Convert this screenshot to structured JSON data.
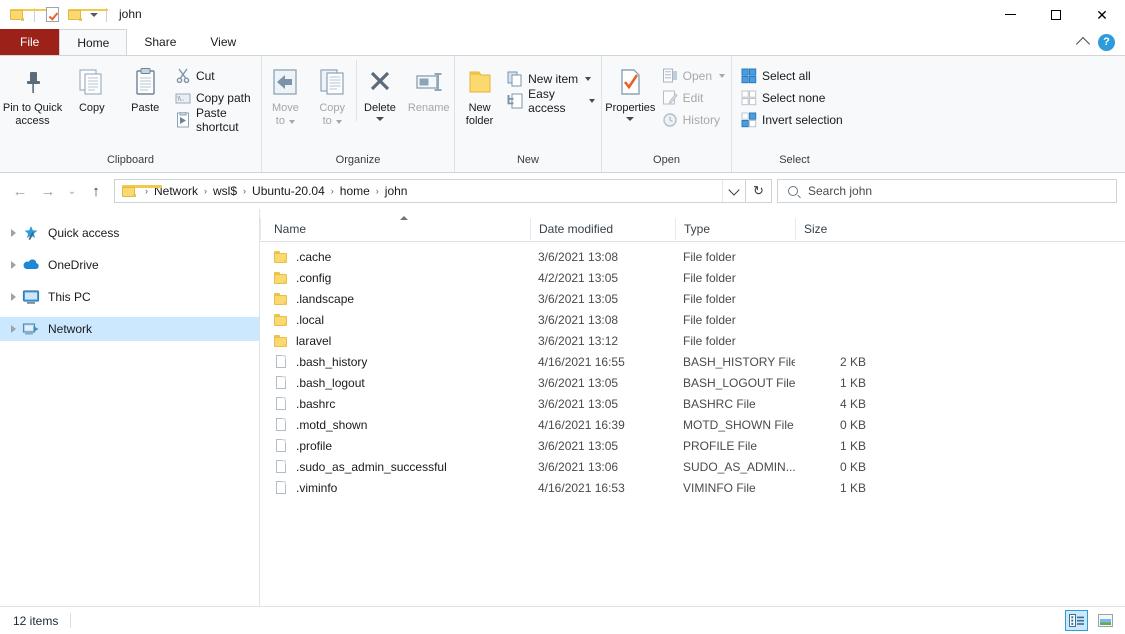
{
  "window": {
    "title": "john",
    "quick_access_toolbar": [
      {
        "name": "folder-icon",
        "label": "Properties"
      },
      {
        "name": "properties-icon",
        "label": "Properties"
      },
      {
        "name": "new-folder-icon",
        "label": "New folder"
      },
      {
        "name": "customize-caret",
        "label": "Customize Quick Access Toolbar"
      }
    ],
    "controls": {
      "minimize": "—",
      "maximize": "□",
      "close": "✕"
    }
  },
  "ribbon": {
    "tabs": [
      {
        "label": "File",
        "active": false,
        "kind": "file"
      },
      {
        "label": "Home",
        "active": true,
        "kind": "normal"
      },
      {
        "label": "Share",
        "active": false,
        "kind": "normal"
      },
      {
        "label": "View",
        "active": false,
        "kind": "normal"
      }
    ],
    "collapse_label": "Minimize the Ribbon",
    "help_label": "?",
    "groups": [
      {
        "label": "Clipboard",
        "big_buttons": [
          {
            "label_line1": "Pin to Quick",
            "label_line2": "access",
            "icon": "pin-icon",
            "disabled": false
          },
          {
            "label_line1": "Copy",
            "label_line2": "",
            "icon": "copy-icon",
            "disabled": false
          },
          {
            "label_line1": "Paste",
            "label_line2": "",
            "icon": "paste-icon",
            "disabled": false
          }
        ],
        "small_buttons": [
          {
            "label": "Cut",
            "icon": "cut-icon",
            "disabled": false,
            "caret": false
          },
          {
            "label": "Copy path",
            "icon": "copy-path-icon",
            "disabled": false,
            "caret": false
          },
          {
            "label": "Paste shortcut",
            "icon": "paste-shortcut-icon",
            "disabled": false,
            "caret": false
          }
        ]
      },
      {
        "label": "Organize",
        "big_buttons": [
          {
            "label_line1": "Move",
            "label_line2": "to",
            "icon": "move-to-icon",
            "disabled": true,
            "caret": true
          },
          {
            "label_line1": "Copy",
            "label_line2": "to",
            "icon": "copy-to-icon",
            "disabled": true,
            "caret": true
          },
          {
            "label_line1": "Delete",
            "label_line2": "",
            "icon": "delete-icon",
            "disabled": false,
            "caret": true
          },
          {
            "label_line1": "Rename",
            "label_line2": "",
            "icon": "rename-icon",
            "disabled": true,
            "caret": false
          }
        ],
        "small_buttons": []
      },
      {
        "label": "New",
        "big_buttons": [
          {
            "label_line1": "New",
            "label_line2": "folder",
            "icon": "new-folder-icon",
            "disabled": false
          }
        ],
        "small_buttons": [
          {
            "label": "New item",
            "icon": "new-item-icon",
            "disabled": false,
            "caret": true
          },
          {
            "label": "Easy access",
            "icon": "easy-access-icon",
            "disabled": false,
            "caret": true
          }
        ]
      },
      {
        "label": "Open",
        "big_buttons": [
          {
            "label_line1": "Properties",
            "label_line2": "",
            "icon": "properties-icon",
            "disabled": false,
            "caret": true
          }
        ],
        "small_buttons": [
          {
            "label": "Open",
            "icon": "open-icon",
            "disabled": true,
            "caret": true
          },
          {
            "label": "Edit",
            "icon": "edit-icon",
            "disabled": true,
            "caret": false
          },
          {
            "label": "History",
            "icon": "history-icon",
            "disabled": true,
            "caret": false
          }
        ]
      },
      {
        "label": "Select",
        "big_buttons": [],
        "small_buttons": [
          {
            "label": "Select all",
            "icon": "select-all-icon",
            "disabled": false,
            "caret": false
          },
          {
            "label": "Select none",
            "icon": "select-none-icon",
            "disabled": false,
            "caret": false
          },
          {
            "label": "Invert selection",
            "icon": "invert-selection-icon",
            "disabled": false,
            "caret": false
          }
        ]
      }
    ]
  },
  "addressbar": {
    "back_label": "←",
    "forward_label": "→",
    "recent_label": "∨",
    "up_label": "↑",
    "breadcrumbs": [
      "Network",
      "wsl$",
      "Ubuntu-20.04",
      "home",
      "john"
    ],
    "separator": "›",
    "refresh_label": "↻",
    "search_placeholder": "Search john",
    "search_value": ""
  },
  "navigation_pane": {
    "items": [
      {
        "label": "Quick access",
        "icon": "quick-access-star-icon",
        "selected": false
      },
      {
        "label": "OneDrive",
        "icon": "onedrive-cloud-icon",
        "selected": false
      },
      {
        "label": "This PC",
        "icon": "this-pc-icon",
        "selected": false
      },
      {
        "label": "Network",
        "icon": "network-icon",
        "selected": true
      }
    ]
  },
  "file_list": {
    "columns": [
      {
        "label": "Name",
        "sorted": "asc"
      },
      {
        "label": "Date modified",
        "sorted": null
      },
      {
        "label": "Type",
        "sorted": null
      },
      {
        "label": "Size",
        "sorted": null
      }
    ],
    "rows": [
      {
        "name": ".cache",
        "date": "3/6/2021 13:08",
        "type": "File folder",
        "size": "",
        "kind": "folder"
      },
      {
        "name": ".config",
        "date": "4/2/2021 13:05",
        "type": "File folder",
        "size": "",
        "kind": "folder"
      },
      {
        "name": ".landscape",
        "date": "3/6/2021 13:05",
        "type": "File folder",
        "size": "",
        "kind": "folder"
      },
      {
        "name": ".local",
        "date": "3/6/2021 13:08",
        "type": "File folder",
        "size": "",
        "kind": "folder"
      },
      {
        "name": "laravel",
        "date": "3/6/2021 13:12",
        "type": "File folder",
        "size": "",
        "kind": "folder"
      },
      {
        "name": ".bash_history",
        "date": "4/16/2021 16:55",
        "type": "BASH_HISTORY File",
        "size": "2 KB",
        "kind": "file"
      },
      {
        "name": ".bash_logout",
        "date": "3/6/2021 13:05",
        "type": "BASH_LOGOUT File",
        "size": "1 KB",
        "kind": "file"
      },
      {
        "name": ".bashrc",
        "date": "3/6/2021 13:05",
        "type": "BASHRC File",
        "size": "4 KB",
        "kind": "file"
      },
      {
        "name": ".motd_shown",
        "date": "4/16/2021 16:39",
        "type": "MOTD_SHOWN File",
        "size": "0 KB",
        "kind": "file"
      },
      {
        "name": ".profile",
        "date": "3/6/2021 13:05",
        "type": "PROFILE File",
        "size": "1 KB",
        "kind": "file"
      },
      {
        "name": ".sudo_as_admin_successful",
        "date": "3/6/2021 13:06",
        "type": "SUDO_AS_ADMIN...",
        "size": "0 KB",
        "kind": "file"
      },
      {
        "name": ".viminfo",
        "date": "4/16/2021 16:53",
        "type": "VIMINFO File",
        "size": "1 KB",
        "kind": "file"
      }
    ]
  },
  "statusbar": {
    "item_count": "12 items",
    "view_buttons": [
      {
        "name": "details-view-button",
        "label": "Details view",
        "active": true
      },
      {
        "name": "large-icons-view-button",
        "label": "Large icons view",
        "active": false
      }
    ]
  },
  "colors": {
    "file_tab": "#9c2119",
    "ribbon_bg": "#f7f9fb",
    "selection": "#cce8ff",
    "accent": "#2e9bdb",
    "folder": "#fcd96f"
  }
}
